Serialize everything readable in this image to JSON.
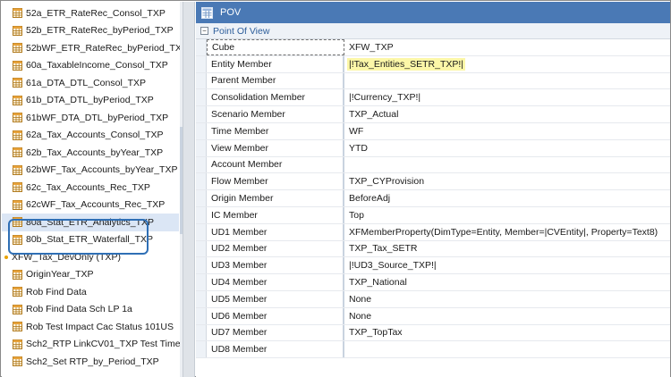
{
  "tree": {
    "items": [
      {
        "label": "52a_ETR_RateRec_Consol_TXP",
        "type": "table"
      },
      {
        "label": "52b_ETR_RateRec_byPeriod_TXP",
        "type": "table"
      },
      {
        "label": "52bWF_ETR_RateRec_byPeriod_TXP",
        "type": "table"
      },
      {
        "label": "60a_TaxableIncome_Consol_TXP",
        "type": "table"
      },
      {
        "label": "61a_DTA_DTL_Consol_TXP",
        "type": "table"
      },
      {
        "label": "61b_DTA_DTL_byPeriod_TXP",
        "type": "table"
      },
      {
        "label": "61bWF_DTA_DTL_byPeriod_TXP",
        "type": "table"
      },
      {
        "label": "62a_Tax_Accounts_Consol_TXP",
        "type": "table"
      },
      {
        "label": "62b_Tax_Accounts_byYear_TXP",
        "type": "table"
      },
      {
        "label": "62bWF_Tax_Accounts_byYear_TXP",
        "type": "table"
      },
      {
        "label": "62c_Tax_Accounts_Rec_TXP",
        "type": "table"
      },
      {
        "label": "62cWF_Tax_Accounts_Rec_TXP",
        "type": "table"
      },
      {
        "label": "80a_Stat_ETR_Analytics_TXP",
        "type": "table",
        "selected": true
      },
      {
        "label": "80b_Stat_ETR_Waterfall_TXP",
        "type": "table"
      },
      {
        "label": "XFW_Tax_DevOnly (TXP)",
        "type": "group"
      },
      {
        "label": "OriginYear_TXP",
        "type": "table"
      },
      {
        "label": "Rob Find Data",
        "type": "table"
      },
      {
        "label": "Rob Find Data Sch LP 1a",
        "type": "table"
      },
      {
        "label": "Rob Test Impact Cac Status 101US",
        "type": "table"
      },
      {
        "label": "Sch2_RTP LinkCV01_TXP Test Time Peri",
        "type": "table"
      },
      {
        "label": "Sch2_Set RTP_by_Period_TXP",
        "type": "table"
      }
    ]
  },
  "panel": {
    "title": "POV",
    "group_title": "Point Of View",
    "group_toggle": "−"
  },
  "pov": [
    {
      "name": "Cube",
      "value": "XFW_TXP"
    },
    {
      "name": "Entity Member",
      "value": "|!Tax_Entities_SETR_TXP!|",
      "highlight": true
    },
    {
      "name": "Parent Member",
      "value": ""
    },
    {
      "name": "Consolidation Member",
      "value": "|!Currency_TXP!|"
    },
    {
      "name": "Scenario Member",
      "value": "TXP_Actual"
    },
    {
      "name": "Time Member",
      "value": "WF"
    },
    {
      "name": "View Member",
      "value": "YTD"
    },
    {
      "name": "Account Member",
      "value": ""
    },
    {
      "name": "Flow Member",
      "value": "TXP_CYProvision"
    },
    {
      "name": "Origin Member",
      "value": "BeforeAdj"
    },
    {
      "name": "IC Member",
      "value": "Top"
    },
    {
      "name": "UD1 Member",
      "value": "XFMemberProperty(DimType=Entity, Member=|CVEntity|, Property=Text8)"
    },
    {
      "name": "UD2 Member",
      "value": "TXP_Tax_SETR"
    },
    {
      "name": "UD3 Member",
      "value": "|!UD3_Source_TXP!|"
    },
    {
      "name": "UD4 Member",
      "value": "TXP_National"
    },
    {
      "name": "UD5 Member",
      "value": "None"
    },
    {
      "name": "UD6 Member",
      "value": "None"
    },
    {
      "name": "UD7 Member",
      "value": "TXP_TopTax"
    },
    {
      "name": "UD8 Member",
      "value": ""
    }
  ],
  "colors": {
    "header": "#4a79b5",
    "highlight": "#fcf7a8",
    "selection_box": "#2f6fb5",
    "group_dot": "#e8a200"
  },
  "icons": {
    "tree_table": "table-grid-icon",
    "panel_header": "grid-icon"
  }
}
